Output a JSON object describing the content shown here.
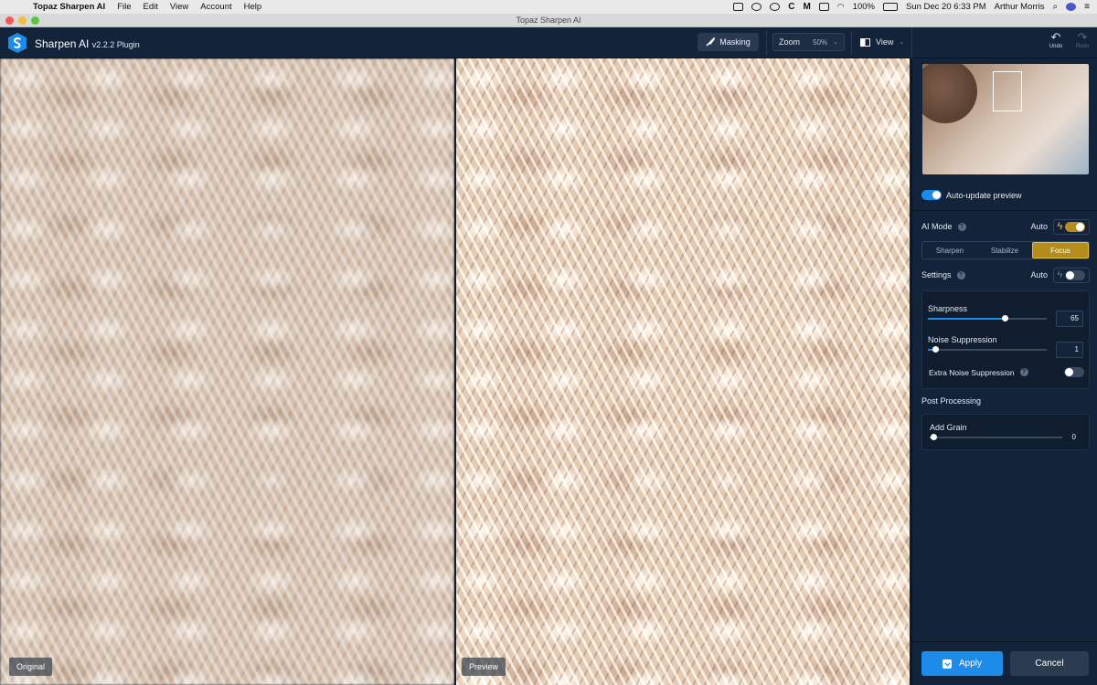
{
  "menubar": {
    "app_name": "Topaz Sharpen AI",
    "items": [
      "File",
      "Edit",
      "View",
      "Account",
      "Help"
    ],
    "battery": "100%",
    "datetime": "Sun Dec 20  6:33 PM",
    "user": "Arthur Morris"
  },
  "window": {
    "title": "Topaz Sharpen AI"
  },
  "toolbar": {
    "app_title": "Sharpen AI",
    "version": "v2.2.2 Plugin",
    "masking_label": "Masking",
    "zoom_label": "Zoom",
    "zoom_value": "50%",
    "view_label": "View",
    "undo_label": "Undo",
    "redo_label": "Redo"
  },
  "panes": {
    "left_label": "Original",
    "right_label": "Preview"
  },
  "sidebar": {
    "auto_update_label": "Auto-update preview",
    "ai_mode_label": "AI Mode",
    "auto_label": "Auto",
    "modes": [
      "Sharpen",
      "Stabilize",
      "Focus"
    ],
    "active_mode": "Focus",
    "settings_label": "Settings",
    "sharpness_label": "Sharpness",
    "sharpness_value": "65",
    "noise_label": "Noise Suppression",
    "noise_value": "1",
    "extra_noise_label": "Extra Noise Suppression",
    "post_processing_label": "Post Processing",
    "grain_label": "Add Grain",
    "grain_value": "0",
    "apply_label": "Apply",
    "cancel_label": "Cancel",
    "accent_color": "#1c8bea",
    "mode_active_color": "#b58c1e"
  }
}
